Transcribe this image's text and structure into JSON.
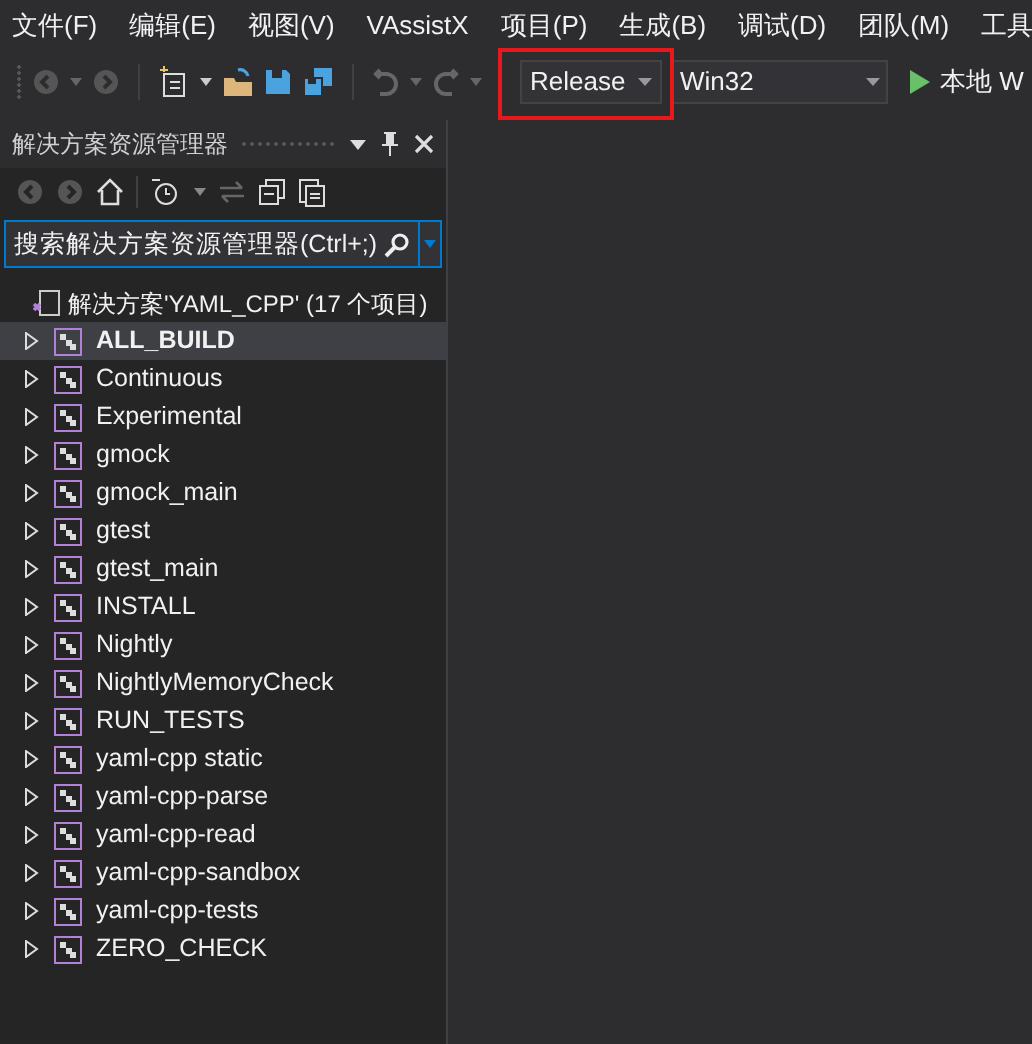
{
  "menu": [
    {
      "label": "文件(F)"
    },
    {
      "label": "编辑(E)"
    },
    {
      "label": "视图(V)"
    },
    {
      "label": "VAssistX"
    },
    {
      "label": "项目(P)"
    },
    {
      "label": "生成(B)"
    },
    {
      "label": "调试(D)"
    },
    {
      "label": "团队(M)"
    },
    {
      "label": "工具"
    }
  ],
  "toolbar": {
    "configuration": {
      "value": "Release",
      "highlighted": true
    },
    "platform": {
      "value": "Win32"
    },
    "run_label": "本地 W"
  },
  "solution_explorer": {
    "title": "解决方案资源管理器",
    "search": {
      "placeholder": "搜索解决方案资源管理器(Ctrl+;)"
    },
    "solution": "解决方案'YAML_CPP' (17 个项目)",
    "projects": [
      {
        "name": "ALL_BUILD",
        "selected": true,
        "expanded": false
      },
      {
        "name": "Continuous",
        "selected": false,
        "expanded": false
      },
      {
        "name": "Experimental",
        "selected": false,
        "expanded": false
      },
      {
        "name": "gmock",
        "selected": false,
        "expanded": false
      },
      {
        "name": "gmock_main",
        "selected": false,
        "expanded": false
      },
      {
        "name": "gtest",
        "selected": false,
        "expanded": false
      },
      {
        "name": "gtest_main",
        "selected": false,
        "expanded": false
      },
      {
        "name": "INSTALL",
        "selected": false,
        "expanded": false
      },
      {
        "name": "Nightly",
        "selected": false,
        "expanded": false
      },
      {
        "name": "NightlyMemoryCheck",
        "selected": false,
        "expanded": false
      },
      {
        "name": "RUN_TESTS",
        "selected": false,
        "expanded": false
      },
      {
        "name": "yaml-cpp static",
        "selected": false,
        "expanded": false
      },
      {
        "name": "yaml-cpp-parse",
        "selected": false,
        "expanded": false
      },
      {
        "name": "yaml-cpp-read",
        "selected": false,
        "expanded": false
      },
      {
        "name": "yaml-cpp-sandbox",
        "selected": false,
        "expanded": false
      },
      {
        "name": "yaml-cpp-tests",
        "selected": false,
        "expanded": false
      },
      {
        "name": "ZERO_CHECK",
        "selected": false,
        "expanded": false
      }
    ]
  }
}
